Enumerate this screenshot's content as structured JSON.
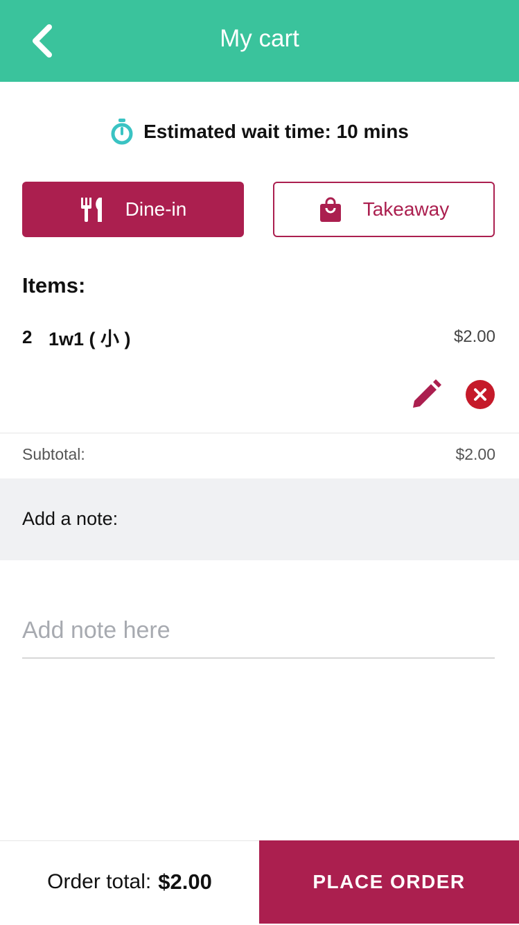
{
  "header": {
    "title": "My cart",
    "back_icon": "chevron-left-icon"
  },
  "wait": {
    "icon": "stopwatch-icon",
    "text": "Estimated wait time: 10 mins",
    "icon_color": "#3ac3c3"
  },
  "order_type": {
    "dine_in": {
      "label": "Dine-in",
      "icon": "utensils-icon",
      "selected": true
    },
    "takeaway": {
      "label": "Takeaway",
      "icon": "shopping-bag-icon",
      "selected": false
    }
  },
  "items": {
    "heading": "Items:",
    "list": [
      {
        "qty": "2",
        "name": "1w1 ( 小 )",
        "price": "$2.00"
      }
    ]
  },
  "subtotal": {
    "label": "Subtotal:",
    "value": "$2.00"
  },
  "note": {
    "label": "Add a note:",
    "placeholder": "Add note here",
    "value": ""
  },
  "footer": {
    "total_label": "Order total:",
    "total_value": "$2.00",
    "place_order_label": "PLACE ORDER"
  },
  "colors": {
    "header": "#3ac39c",
    "accent": "#ab1f4f",
    "remove": "#c51a2a"
  }
}
